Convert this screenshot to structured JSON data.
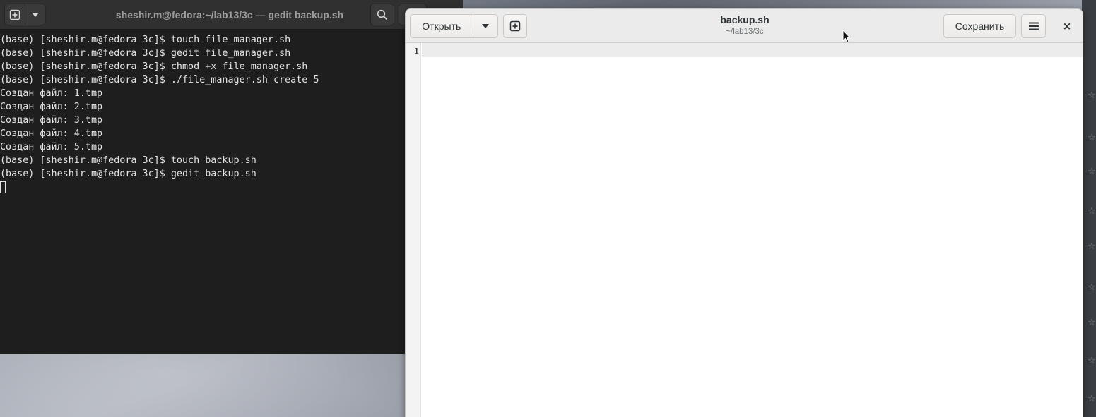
{
  "terminal": {
    "title": "sheshir.m@fedora:~/lab13/3c — gedit backup.sh",
    "new_tab_icon": "new-tab-icon",
    "menu_icon": "chevron-down-icon",
    "search_icon": "search-icon",
    "lines": [
      "(base) [sheshir.m@fedora 3c]$ touch file_manager.sh",
      "(base) [sheshir.m@fedora 3c]$ gedit file_manager.sh",
      "(base) [sheshir.m@fedora 3c]$ chmod +x file_manager.sh",
      "(base) [sheshir.m@fedora 3c]$ ./file_manager.sh create 5",
      "Создан файл: 1.tmp",
      "Создан файл: 2.tmp",
      "Создан файл: 3.tmp",
      "Создан файл: 4.tmp",
      "Создан файл: 5.tmp",
      "(base) [sheshir.m@fedora 3c]$ touch backup.sh",
      "(base) [sheshir.m@fedora 3c]$ gedit backup.sh"
    ]
  },
  "gedit": {
    "open_label": "Открыть",
    "save_label": "Сохранить",
    "file_name": "backup.sh",
    "file_path": "~/lab13/3c",
    "close_glyph": "×",
    "line_number": "1"
  },
  "colors": {
    "terminal_bg": "#1e1e1e",
    "terminal_fg": "#e4e4e4",
    "header_dark": "#303030",
    "gedit_header": "#ebebeb"
  }
}
